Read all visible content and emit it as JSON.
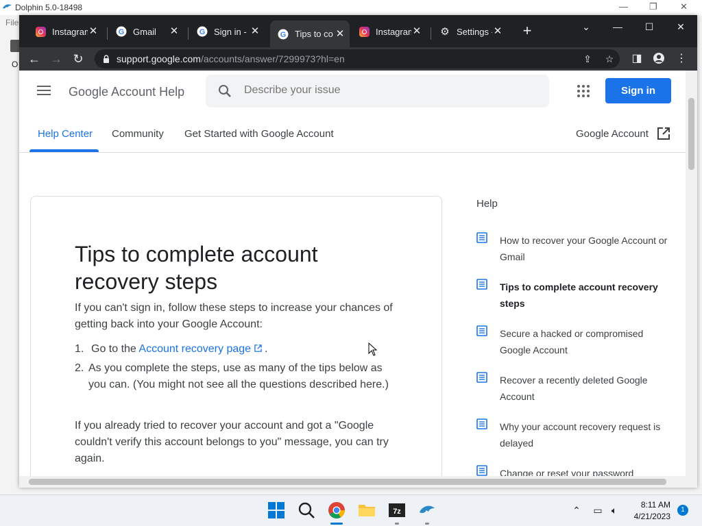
{
  "background_app": {
    "title": "Dolphin 5.0-18498",
    "menu_label": "File",
    "side_letter": "O"
  },
  "browser": {
    "tabs": [
      {
        "label": "Instagram",
        "icon": "instagram-icon"
      },
      {
        "label": "Gmail",
        "icon": "google-icon"
      },
      {
        "label": "Sign in - G",
        "icon": "google-icon"
      },
      {
        "label": "Tips to co",
        "icon": "google-icon",
        "active": true
      },
      {
        "label": "Instagram",
        "icon": "instagram-icon"
      },
      {
        "label": "Settings -",
        "icon": "gear-icon"
      }
    ],
    "url_host": "support.google.com",
    "url_path": "/accounts/answer/7299973?hl=en"
  },
  "header": {
    "site_title": "Google Account Help",
    "search_placeholder": "Describe your issue",
    "signin_label": "Sign in"
  },
  "nav": {
    "tabs": [
      "Help Center",
      "Community",
      "Get Started with Google Account"
    ],
    "account_link": "Google Account"
  },
  "article": {
    "title": "Tips to complete account recovery steps",
    "intro": "If you can't sign in, follow these steps to increase your chances of getting back into your Google Account:",
    "step1_num": "1.",
    "step1_prefix": "Go to the ",
    "step1_link": "Account recovery page",
    "step1_suffix": ".",
    "step2_num": "2.",
    "step2_text": "As you complete the steps, use as many of the tips below as you can. (You might not see all the questions described here.)",
    "para2": "If you already tried to recover your account and got a \"Google couldn't verify this account belongs to you\" message, you can try again."
  },
  "help_sidebar": {
    "heading": "Help",
    "items": [
      {
        "label": "How to recover your Google Account or Gmail"
      },
      {
        "label": "Tips to complete account recovery steps",
        "current": true
      },
      {
        "label": "Secure a hacked or compromised Google Account"
      },
      {
        "label": "Recover a recently deleted Google Account"
      },
      {
        "label": "Why your account recovery request is delayed"
      },
      {
        "label": "Change or reset your password"
      }
    ]
  },
  "taskbar": {
    "time": "8:11 AM",
    "date": "4/21/2023",
    "notification_count": "1"
  },
  "colors": {
    "accent": "#1a73e8",
    "tabstrip": "#202124",
    "toolbar": "#35363a"
  }
}
